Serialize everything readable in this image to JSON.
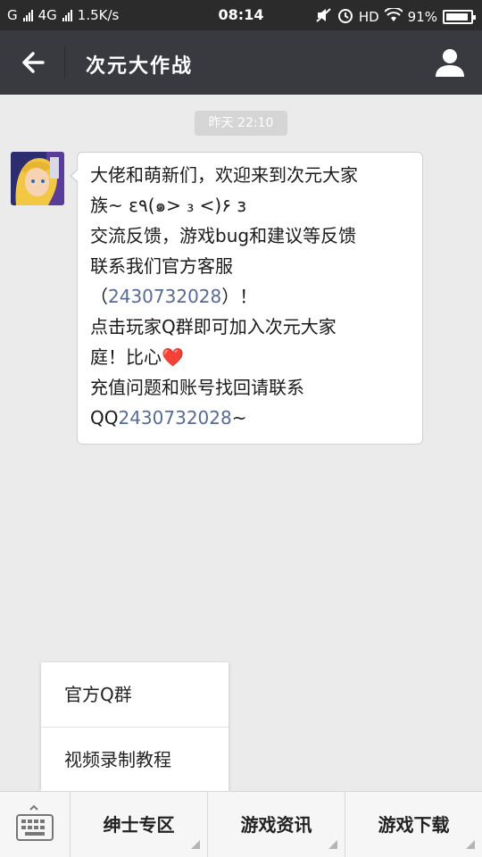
{
  "status": {
    "carrier_left": "G",
    "carrier_mid": "4G",
    "speed": "1.5K/s",
    "time": "08:14",
    "hd": "HD",
    "battery": "91%"
  },
  "header": {
    "title": "次元大作战",
    "back_icon": "arrow-left-icon",
    "profile_icon": "user-icon"
  },
  "chat": {
    "timestamp": "昨天 22:10",
    "message": {
      "line1": "大佬和萌新们，欢迎来到次元大家",
      "line2": "族~ ε٩(๑> ₃ <)۶ з",
      "line3": "交流反馈，游戏bug和建议等反馈",
      "line4": "联系我们官方客服",
      "line5_open": "（",
      "line5_number": "2430732028",
      "line5_close": "）！",
      "line6": "点击玩家Q群即可加入次元大家",
      "line7_text": "庭！比心",
      "line7_emoji": "❤️",
      "line8": "充值问题和账号找回请联系",
      "line9_prefix": "QQ",
      "line9_number": "2430732028",
      "line9_suffix": "~"
    }
  },
  "popup": {
    "items": [
      {
        "label": "官方Q群"
      },
      {
        "label": "视频录制教程"
      }
    ]
  },
  "bottom_menu": {
    "keyboard_icon": "keyboard-icon",
    "tabs": [
      {
        "label": "绅士专区"
      },
      {
        "label": "游戏资讯"
      },
      {
        "label": "游戏下载"
      }
    ]
  }
}
